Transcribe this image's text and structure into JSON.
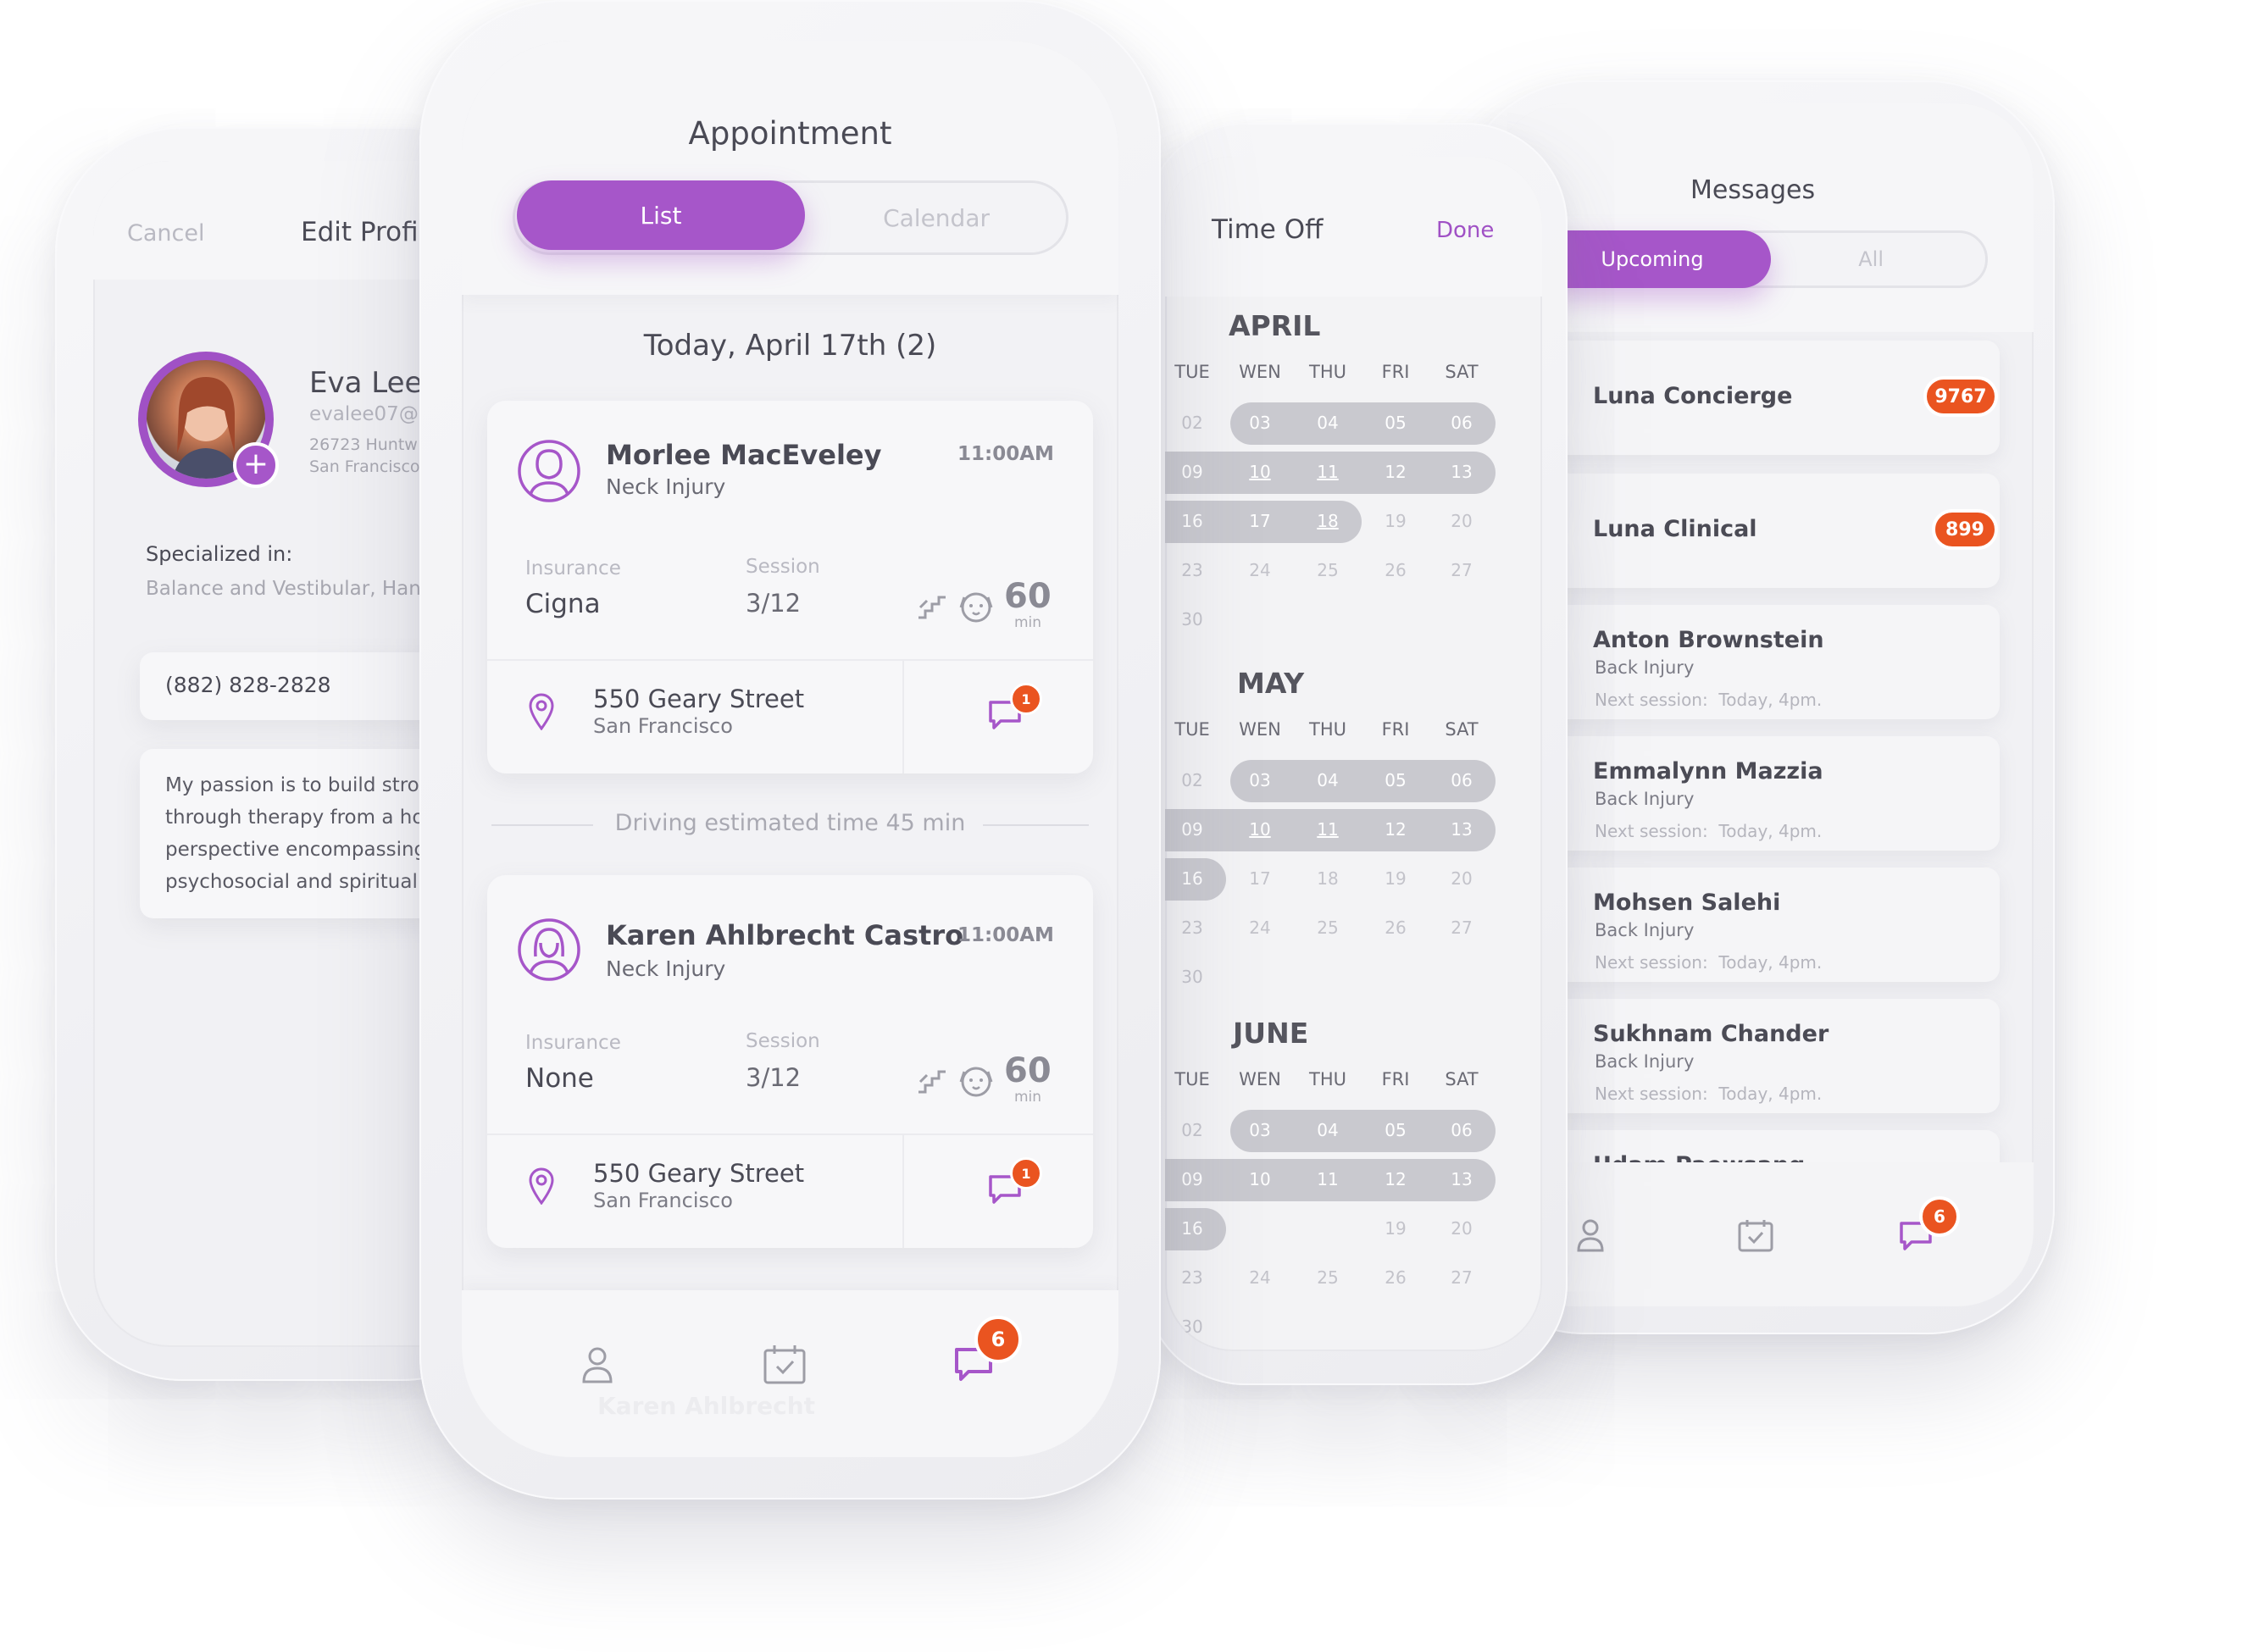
{
  "edit_profile": {
    "cancel_label": "Cancel",
    "title": "Edit Profile",
    "name": "Eva Lee",
    "email": "evalee07@",
    "address_line1": "26723 Huntw",
    "address_line2": "San Francisco",
    "specialized_label": "Specialized in:",
    "specialized_value": "Balance and Vestibular, Hand",
    "phone": "(882) 828-2828",
    "bio_lines": [
      "My passion is to build stron",
      "through therapy from a ho",
      "perspective encompassing",
      "psychosocial and spiritual"
    ],
    "add_icon": "plus-icon"
  },
  "appointment": {
    "title": "Appointment",
    "tabs": [
      {
        "label": "List",
        "active": true
      },
      {
        "label": "Calendar",
        "active": false
      }
    ],
    "date_header": "Today, April 17th (2)",
    "cards": [
      {
        "name": "Morlee MacEveley",
        "condition": "Neck Injury",
        "time": "11:00AM",
        "insurance_label": "Insurance",
        "insurance": "Cigna",
        "session_label": "Session",
        "session": "3/12",
        "duration": "60",
        "duration_unit": "min",
        "street": "550 Geary Street",
        "city": "San Francisco",
        "chat_badge": "1"
      },
      {
        "name": "Karen Ahlbrecht Castro",
        "condition": "Neck Injury",
        "time": "11:00AM",
        "insurance_label": "Insurance",
        "insurance": "None",
        "session_label": "Session",
        "session": "3/12",
        "duration": "60",
        "duration_unit": "min",
        "street": "550 Geary Street",
        "city": "San Francisco",
        "chat_badge": "1"
      }
    ],
    "driving_note": "Driving estimated time 45 min",
    "ghost_name": "Karen Ahlbrecht",
    "nav_badge": "6"
  },
  "time_off": {
    "title": "Time Off",
    "done_label": "Done",
    "weekdays": [
      "TUE",
      "WEN",
      "THU",
      "FRI",
      "SAT"
    ],
    "months": [
      {
        "name": "APRIL",
        "rows": [
          [
            "02",
            "03",
            "04",
            "05",
            "06"
          ],
          [
            "09",
            "10",
            "11",
            "12",
            "13"
          ],
          [
            "16",
            "17",
            "18",
            "19",
            "20"
          ],
          [
            "23",
            "24",
            "25",
            "26",
            "27"
          ],
          [
            "30"
          ]
        ]
      },
      {
        "name": "MAY",
        "rows": [
          [
            "02",
            "03",
            "04",
            "05",
            "06"
          ],
          [
            "09",
            "10",
            "11",
            "12",
            "13"
          ],
          [
            "16",
            "17",
            "18",
            "19",
            "20"
          ],
          [
            "23",
            "24",
            "25",
            "26",
            "27"
          ],
          [
            "30"
          ]
        ]
      },
      {
        "name": "JUNE",
        "rows": [
          [
            "02",
            "03",
            "04",
            "05",
            "06"
          ],
          [
            "09",
            "10",
            "11",
            "12",
            "13"
          ],
          [
            "16",
            "",
            "",
            "19",
            "20"
          ],
          [
            "23",
            "24",
            "25",
            "26",
            "27"
          ],
          [
            "30"
          ]
        ]
      }
    ]
  },
  "messages": {
    "title": "Messages",
    "tabs": [
      {
        "label": "Upcoming",
        "active": true
      },
      {
        "label": "All",
        "active": false
      }
    ],
    "items": [
      {
        "name": "Luna Concierge",
        "badge": "9767"
      },
      {
        "name": "Luna Clinical",
        "badge": "899"
      },
      {
        "name": "Anton Brownstein",
        "sub": "Back Injury",
        "next": "Next session:  Today, 4pm."
      },
      {
        "name": "Emmalynn Mazzia",
        "sub": "Back Injury",
        "next": "Next session:  Today, 4pm."
      },
      {
        "name": "Mohsen Salehi",
        "sub": "Back Injury",
        "next": "Next session:  Today, 4pm."
      },
      {
        "name": "Sukhnam Chander",
        "sub": "Back Injury",
        "next": "Next session:  Today, 4pm."
      },
      {
        "name": "Udam Paewsang"
      }
    ],
    "nav_badge": "6"
  },
  "colors": {
    "accent": "#a656c9",
    "badge": "#ea5420",
    "background": "#ffffff"
  }
}
